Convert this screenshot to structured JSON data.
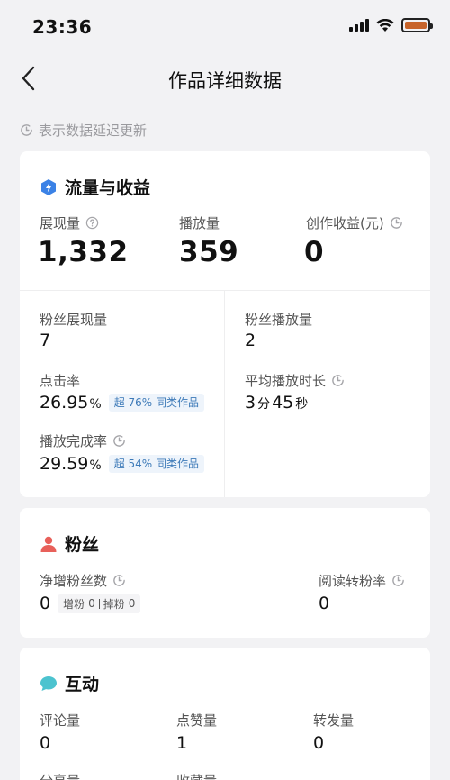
{
  "status_bar": {
    "time": "23:36",
    "battery_color": "#c8642a"
  },
  "nav": {
    "title": "作品详细数据"
  },
  "delay_note": "表示数据延迟更新",
  "traffic": {
    "title": "流量与收益",
    "impressions": {
      "label": "展现量",
      "value": "1,332"
    },
    "plays": {
      "label": "播放量",
      "value": "359"
    },
    "earnings": {
      "label": "创作收益(元)",
      "value": "0"
    },
    "fan_impressions": {
      "label": "粉丝展现量",
      "value": "7"
    },
    "fan_plays": {
      "label": "粉丝播放量",
      "value": "2"
    },
    "ctr": {
      "label": "点击率",
      "value": "26.95",
      "suffix": "%",
      "badge": "超 76% 同类作品"
    },
    "avg_duration": {
      "label": "平均播放时长",
      "min": "3",
      "min_unit": "分",
      "sec": "45",
      "sec_unit": "秒"
    },
    "completion": {
      "label": "播放完成率",
      "value": "29.59",
      "suffix": "%",
      "badge": "超 54% 同类作品"
    }
  },
  "fans": {
    "title": "粉丝",
    "net_gain": {
      "label": "净增粉丝数",
      "value": "0",
      "gain_label": "增粉",
      "gain_value": "0",
      "lose_label": "掉粉",
      "lose_value": "0"
    },
    "conversion": {
      "label": "阅读转粉率",
      "value": "0"
    }
  },
  "interaction": {
    "title": "互动",
    "comments": {
      "label": "评论量",
      "value": "0"
    },
    "likes": {
      "label": "点赞量",
      "value": "1"
    },
    "shares": {
      "label": "转发量",
      "value": "0"
    },
    "share_label": "分享量",
    "favorites_label": "收藏量"
  },
  "colors": {
    "accent_blue": "#3b82e6",
    "fans_red": "#e8605a",
    "interaction_teal": "#4cc3cf"
  }
}
